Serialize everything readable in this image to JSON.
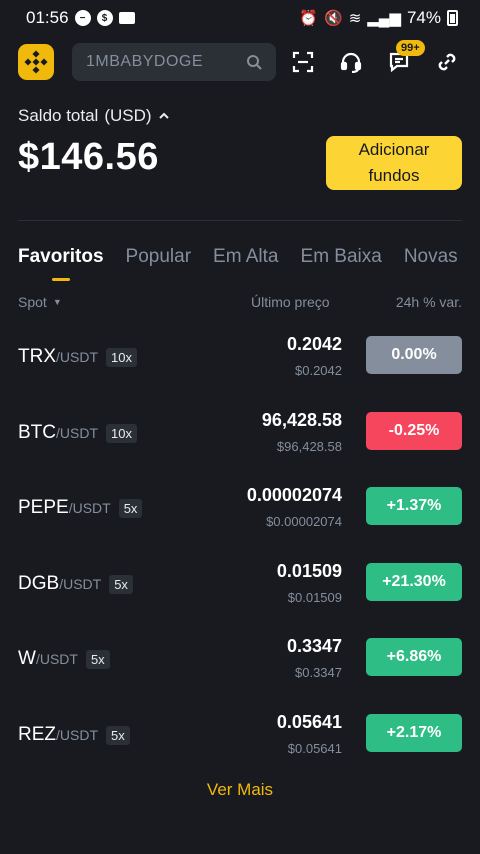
{
  "status": {
    "time": "01:56",
    "battery": "74%"
  },
  "search": {
    "placeholder": "1MBABYDOGE"
  },
  "notifications": {
    "badge": "99+"
  },
  "balance": {
    "label": "Saldo total",
    "currency": "(USD)",
    "value": "$146.56"
  },
  "add_funds": {
    "label": "Adicionar fundos"
  },
  "tabs": [
    "Favoritos",
    "Popular",
    "Em Alta",
    "Em Baixa",
    "Novas"
  ],
  "columns": {
    "spot": "Spot",
    "price": "Último preço",
    "change": "24h % var."
  },
  "rows": [
    {
      "base": "TRX",
      "quote": "/USDT",
      "leverage": "10x",
      "price": "0.2042",
      "usd": "$0.2042",
      "change": "0.00%",
      "color": "#848e9c"
    },
    {
      "base": "BTC",
      "quote": "/USDT",
      "leverage": "10x",
      "price": "96,428.58",
      "usd": "$96,428.58",
      "change": "-0.25%",
      "color": "#f6465d"
    },
    {
      "base": "PEPE",
      "quote": "/USDT",
      "leverage": "5x",
      "price": "0.00002074",
      "usd": "$0.00002074",
      "change": "+1.37%",
      "color": "#2ebd85"
    },
    {
      "base": "DGB",
      "quote": "/USDT",
      "leverage": "5x",
      "price": "0.01509",
      "usd": "$0.01509",
      "change": "+21.30%",
      "color": "#2ebd85"
    },
    {
      "base": "W",
      "quote": "/USDT",
      "leverage": "5x",
      "price": "0.3347",
      "usd": "$0.3347",
      "change": "+6.86%",
      "color": "#2ebd85"
    },
    {
      "base": "REZ",
      "quote": "/USDT",
      "leverage": "5x",
      "price": "0.05641",
      "usd": "$0.05641",
      "change": "+2.17%",
      "color": "#2ebd85"
    }
  ],
  "more": {
    "label": "Ver Mais"
  }
}
